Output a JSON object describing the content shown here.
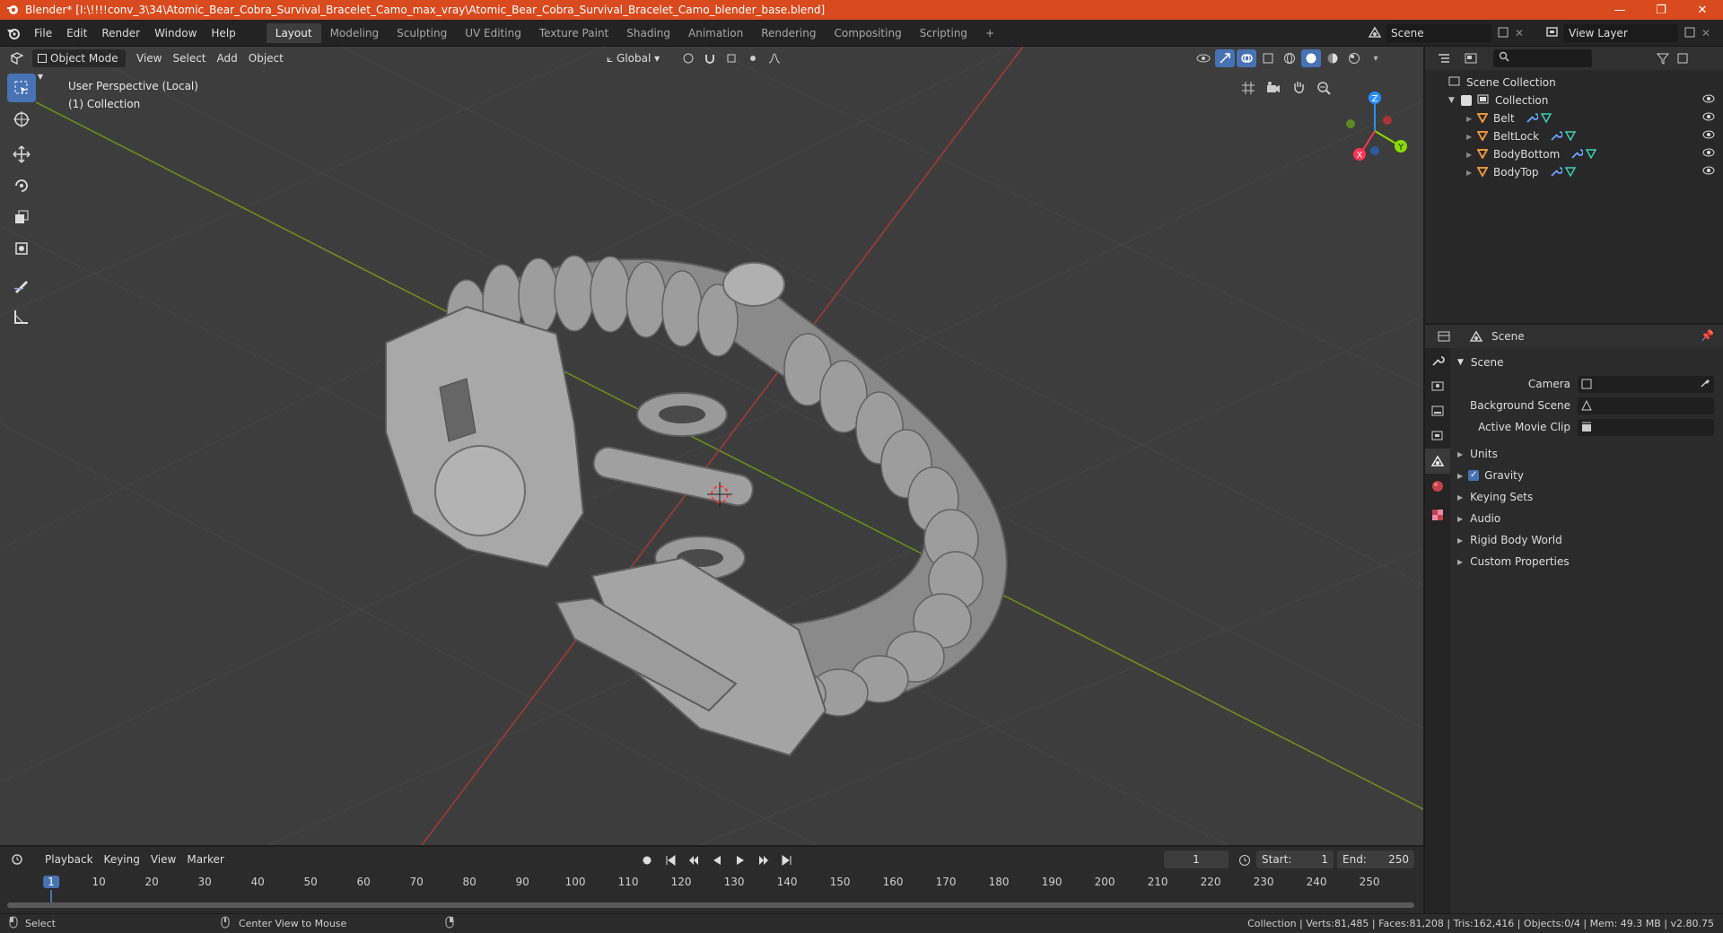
{
  "window": {
    "title": "Blender* [I:\\!!!!conv_3\\34\\Atomic_Bear_Cobra_Survival_Bracelet_Camo_max_vray\\Atomic_Bear_Cobra_Survival_Bracelet_Camo_blender_base.blend]",
    "min": "—",
    "max": "❐",
    "close": "✕"
  },
  "menu": [
    "File",
    "Edit",
    "Render",
    "Window",
    "Help"
  ],
  "workspaces": [
    "Layout",
    "Modeling",
    "Sculpting",
    "UV Editing",
    "Texture Paint",
    "Shading",
    "Animation",
    "Rendering",
    "Compositing",
    "Scripting"
  ],
  "workspace_add": "+",
  "scene_selector": "Scene",
  "view_layer_selector": "View Layer",
  "viewport": {
    "mode": "Object Mode",
    "menus": [
      "View",
      "Select",
      "Add",
      "Object"
    ],
    "transform_orientation": "Global",
    "perspective_label": "User Perspective (Local)",
    "collection_label": "(1) Collection",
    "axes": {
      "x": "X",
      "y": "Y",
      "z": "Z"
    }
  },
  "outliner": {
    "root": "Scene Collection",
    "collection": "Collection",
    "objects": [
      "Belt",
      "BeltLock",
      "BodyBottom",
      "BodyTop"
    ]
  },
  "properties": {
    "header": "Scene",
    "panel": "Scene",
    "camera_label": "Camera",
    "background_scene_label": "Background Scene",
    "active_movie_clip_label": "Active Movie Clip",
    "sections": [
      "Units",
      "Gravity",
      "Keying Sets",
      "Audio",
      "Rigid Body World",
      "Custom Properties"
    ]
  },
  "timeline": {
    "menus": [
      "Playback",
      "Keying",
      "View",
      "Marker"
    ],
    "current_frame": "1",
    "start_label": "Start:",
    "start": "1",
    "end_label": "End:",
    "end": "250",
    "ticks": [
      "1",
      "10",
      "20",
      "30",
      "40",
      "50",
      "60",
      "70",
      "80",
      "90",
      "100",
      "110",
      "120",
      "130",
      "140",
      "150",
      "160",
      "170",
      "180",
      "190",
      "200",
      "210",
      "220",
      "230",
      "240",
      "250"
    ]
  },
  "status": {
    "left_action": "Select",
    "middle_action": "Center View to Mouse",
    "stats": "Collection | Verts:81,485 | Faces:81,208 | Tris:162,416 | Objects:0/4 | Mem: 49.3 MB | v2.80.75"
  },
  "colors": {
    "title_bar": "#d94a1e",
    "accent_blue": "#4772b3",
    "x_axis": "#ff3352",
    "y_axis": "#8bdc00",
    "z_axis": "#2890ff",
    "object_orange": "#e8943a"
  }
}
